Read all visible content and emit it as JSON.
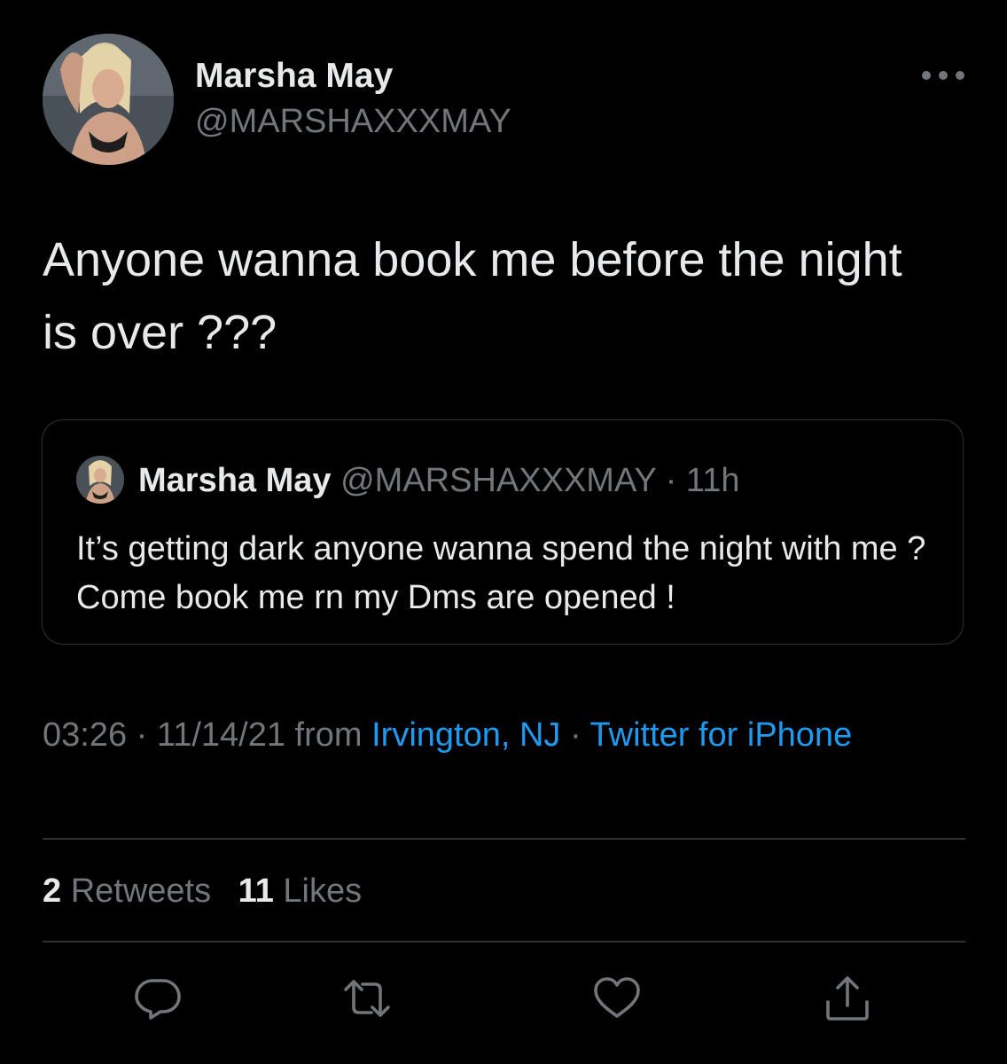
{
  "author": {
    "name": "Marsha May",
    "handle": "@MARSHAXXXMAY"
  },
  "tweet": {
    "text": "Anyone wanna book me before the night is over ???"
  },
  "quoted_tweet": {
    "name": "Marsha May",
    "handle": "@MARSHAXXXMAY",
    "separator": "·",
    "time": "11h",
    "text": "It’s getting dark anyone wanna spend the night with me ? Come book me rn my Dms are opened !"
  },
  "meta": {
    "time": "03:26",
    "sep1": " · ",
    "date": "11/14/21",
    "from": " from ",
    "location": "Irvington, NJ",
    "sep2": " · ",
    "source": "Twitter for iPhone"
  },
  "stats": {
    "retweets_count": "2",
    "retweets_label": "Retweets",
    "likes_count": "11",
    "likes_label": "Likes"
  },
  "icons": {
    "more": "more-horizontal-icon",
    "reply": "reply-icon",
    "retweet": "retweet-icon",
    "like": "heart-icon",
    "share": "share-icon"
  },
  "colors": {
    "background": "#000000",
    "primary_text": "#e7e9ea",
    "secondary_text": "#71767b",
    "link": "#1d9bf0",
    "border": "#2f3336"
  }
}
